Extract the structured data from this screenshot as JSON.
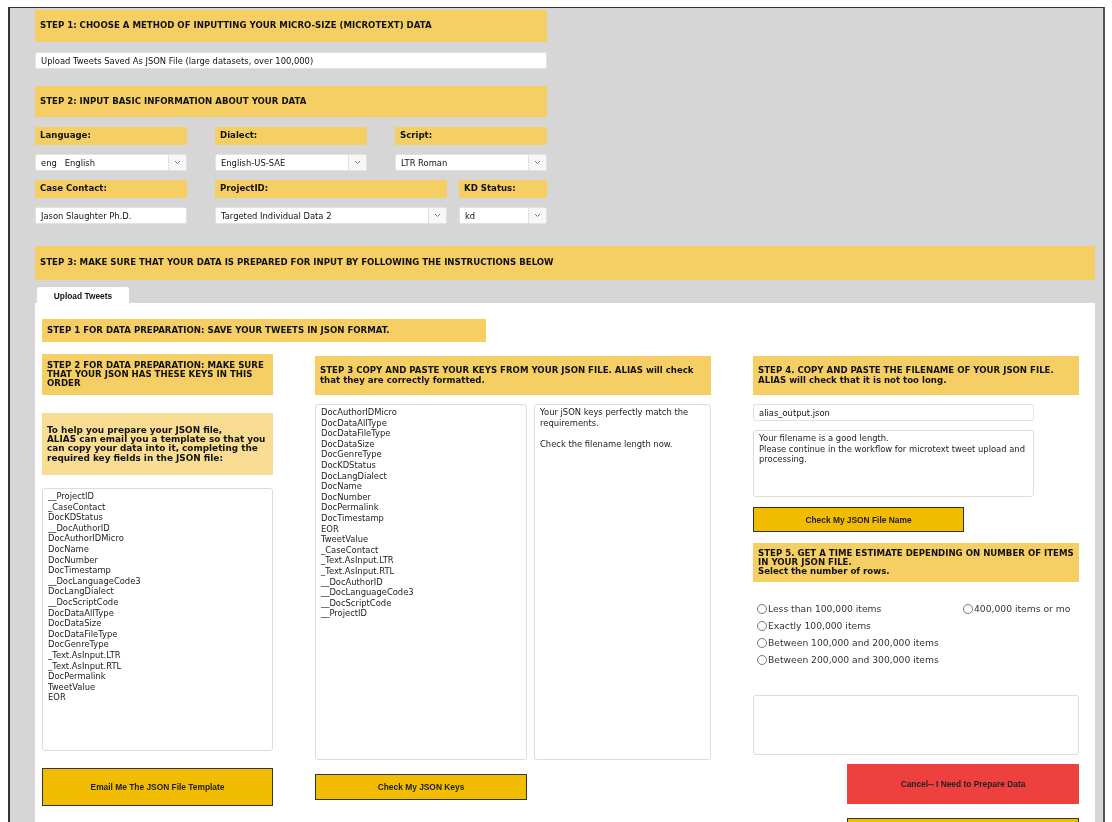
{
  "step1": {
    "heading": "STEP 1: CHOOSE A METHOD OF INPUTTING YOUR MICRO-SIZE (MICROTEXT) DATA",
    "method": {
      "kind": "text",
      "value": "Upload Tweets Saved As JSON File (large datasets, over 100,000)"
    }
  },
  "step2": {
    "heading": "STEP 2: INPUT BASIC INFORMATION ABOUT YOUR DATA",
    "rows": [
      [
        {
          "label": "Language:",
          "kind": "select",
          "value": "eng   English"
        },
        {
          "label": "Dialect:",
          "kind": "select",
          "value": "English-US-SAE"
        },
        {
          "label": "Script:",
          "kind": "select",
          "value": "LTR Roman"
        }
      ],
      [
        {
          "label": "Case Contact:",
          "kind": "text",
          "value": "Jason Slaughter Ph.D."
        },
        {
          "label": "ProjectID:",
          "kind": "select",
          "value": "Targeted Individual Data 2"
        },
        {
          "label": "KD Status:",
          "kind": "select",
          "value": "kd"
        }
      ]
    ]
  },
  "step3": {
    "heading": "STEP 3: MAKE SURE THAT YOUR DATA IS PREPARED FOR INPUT BY FOLLOWING THE INSTRUCTIONS BELOW",
    "tabs": [
      {
        "label": "Upload Tweets",
        "selected": true
      }
    ],
    "prep_step1": {
      "heading": "STEP 1 FOR DATA PREPARATION:  SAVE YOUR TWEETS IN JSON FORMAT."
    },
    "prep_step2": {
      "heading": [
        "STEP 2 FOR DATA PREPARATION:  MAKE SURE THAT YOUR JSON HAS THESE KEYS IN THIS ORDER"
      ],
      "help": [
        "To help you prepare your JSON file,",
        "ALIAS can email you a template so that you can copy your data into it, completing the required key fields in the JSON file:"
      ],
      "keys": [
        "__ProjectID",
        "_CaseContact",
        "DocKDStatus",
        "__DocAuthorID",
        "DocAuthorIDMicro",
        "DocName",
        "DocNumber",
        "DocTimestamp",
        "__DocLanguageCode3",
        "DocLangDialect",
        "__DocScriptCode",
        "DocDataAllType",
        "DocDataSize",
        "DocDataFileType",
        "DocGenreType",
        "_Text.AsInput.LTR",
        "_Text.AsInput.RTL",
        "DocPermalink",
        "TweetValue",
        "EOR"
      ],
      "button": "Email Me The JSON File Template"
    },
    "prep_step3": {
      "heading": [
        "STEP 3 COPY AND PASTE YOUR KEYS FROM YOUR JSON FILE. ALIAS will check that they are correctly formatted."
      ],
      "keys": [
        "DocAuthorIDMicro",
        "DocDataAllType",
        "DocDataFileType",
        "DocDataSize",
        "DocGenreType",
        "DocKDStatus",
        "DocLangDialect",
        "DocName",
        "DocNumber",
        "DocPermalink",
        "DocTimestamp",
        "EOR",
        "TweetValue",
        "_CaseContact",
        "_Text.AsInput.LTR",
        "_Text.AsInput.RTL",
        "__DocAuthorID",
        "__DocLanguageCode3",
        "__DocScriptCode",
        "__ProjectID"
      ],
      "result": [
        "Your jSON keys perfectly match the requirements.",
        "Check the filename length now."
      ],
      "button": "Check My JSON Keys"
    },
    "prep_step4": {
      "heading": [
        "STEP 4. COPY AND PASTE THE FILENAME OF YOUR JSON FILE. ALIAS will check that it is not too long."
      ],
      "filename": "alias_output.json",
      "message": [
        "Your filename is a good length.",
        "Please continue in the workflow for microtext tweet upload and processing."
      ],
      "button": "Check My JSON File Name"
    },
    "prep_step5": {
      "heading": [
        "STEP 5. GET A TIME ESTIMATE DEPENDING ON NUMBER OF ITEMS IN YOUR JSON FILE.",
        "Select the number of rows."
      ],
      "options": [
        {
          "label": "Less than 100,000 items",
          "selected": false
        },
        {
          "label": "Exactly 100,000 items",
          "selected": false
        },
        {
          "label": "Between 100,000 and 200,000 items",
          "selected": false
        },
        {
          "label": "Between 200,000 and 300,000 items",
          "selected": false
        },
        {
          "label": "400,000 items or mo",
          "selected": false
        }
      ],
      "cancel_button": "Cancel-- I Need to Prepare Data"
    }
  }
}
